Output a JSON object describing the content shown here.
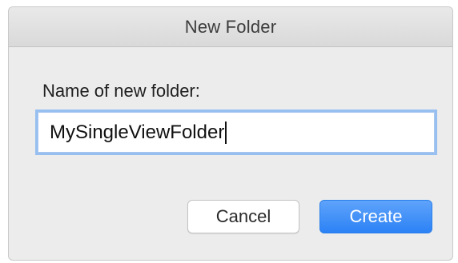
{
  "window": {
    "title": "New Folder"
  },
  "form": {
    "prompt": "Name of new folder:",
    "folder_name_value": "MySingleViewFolder"
  },
  "buttons": {
    "cancel_label": "Cancel",
    "create_label": "Create"
  },
  "colors": {
    "accent": "#2c82f5",
    "focus_ring": "#97bff0"
  }
}
